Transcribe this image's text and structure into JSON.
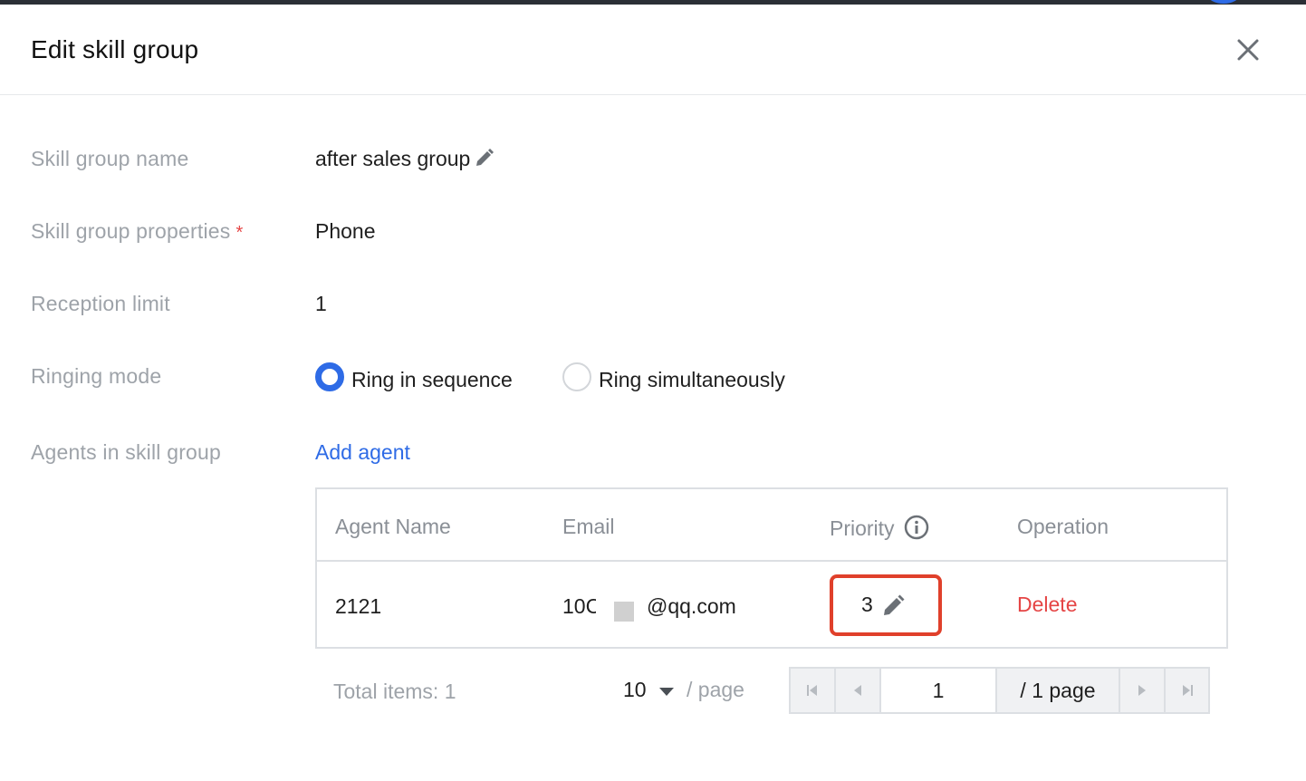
{
  "dialog": {
    "title": "Edit skill group",
    "close_icon": "close-icon"
  },
  "form": {
    "name_label": "Skill group name",
    "name_value": "after sales group",
    "properties_label": "Skill group properties",
    "properties_required_mark": "*",
    "properties_value": "Phone",
    "reception_label": "Reception limit",
    "reception_value": "1",
    "ringing_label": "Ringing mode",
    "ringing_options": [
      {
        "label": "Ring in sequence",
        "selected": true
      },
      {
        "label": "Ring simultaneously",
        "selected": false
      }
    ],
    "agents_label": "Agents in skill group",
    "add_agent_label": "Add agent"
  },
  "table": {
    "columns": [
      "Agent Name",
      "Email",
      "Priority",
      "Operation"
    ],
    "rows": [
      {
        "agent_name": "2121",
        "email_prefix": "10C",
        "email_suffix": "@qq.com",
        "priority": "3",
        "operation": "Delete"
      }
    ]
  },
  "pagination": {
    "total_label": "Total items:",
    "total_value": "1",
    "page_size": "10",
    "per_page_label": "/ page",
    "current_page": "1",
    "total_pages_label": "/ 1 page"
  },
  "colors": {
    "accent": "#2e6be6",
    "danger": "#e54545",
    "highlight_box": "#e0402b"
  }
}
